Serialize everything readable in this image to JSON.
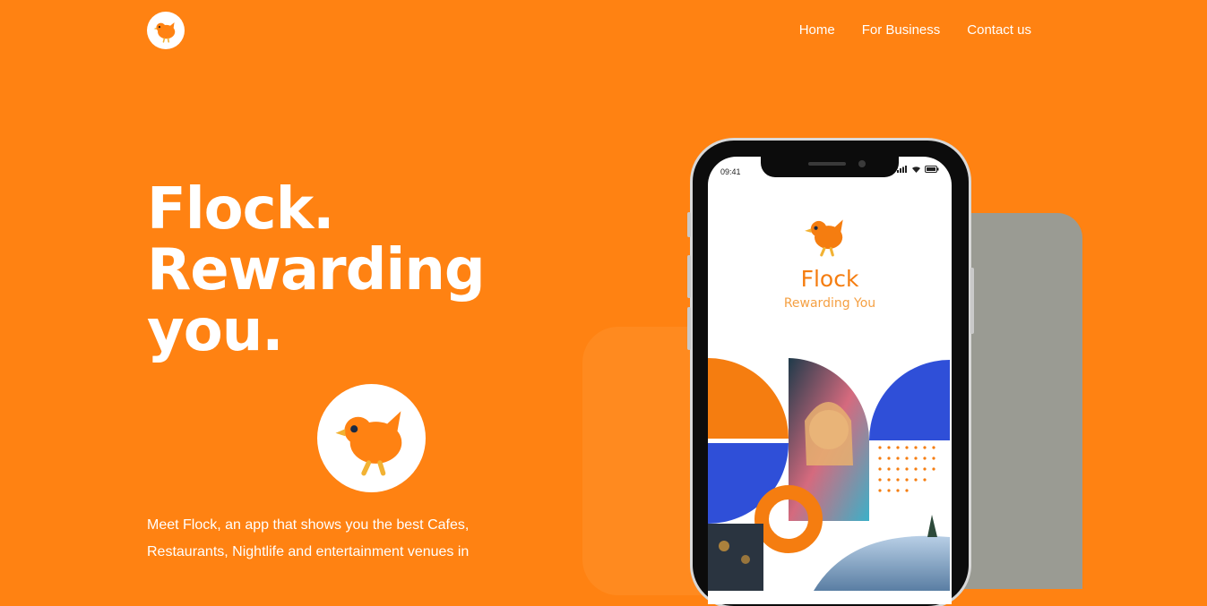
{
  "colors": {
    "background": "#ff8212",
    "accent_blue": "#2f4fd8",
    "phone_text_orange": "#f57d10"
  },
  "header": {
    "logo_icon": "bird-icon",
    "nav": [
      {
        "label": "Home"
      },
      {
        "label": "For Business"
      },
      {
        "label": "Contact us"
      }
    ]
  },
  "hero": {
    "title_lines": [
      "Flock.",
      "Rewarding",
      "you."
    ],
    "description": "Meet Flock, an app that shows you the best Cafes, Restaurants, Nightlife and entertainment venues in"
  },
  "phone": {
    "status_time": "09:41",
    "app_name": "Flock",
    "app_tagline": "Rewarding You"
  }
}
